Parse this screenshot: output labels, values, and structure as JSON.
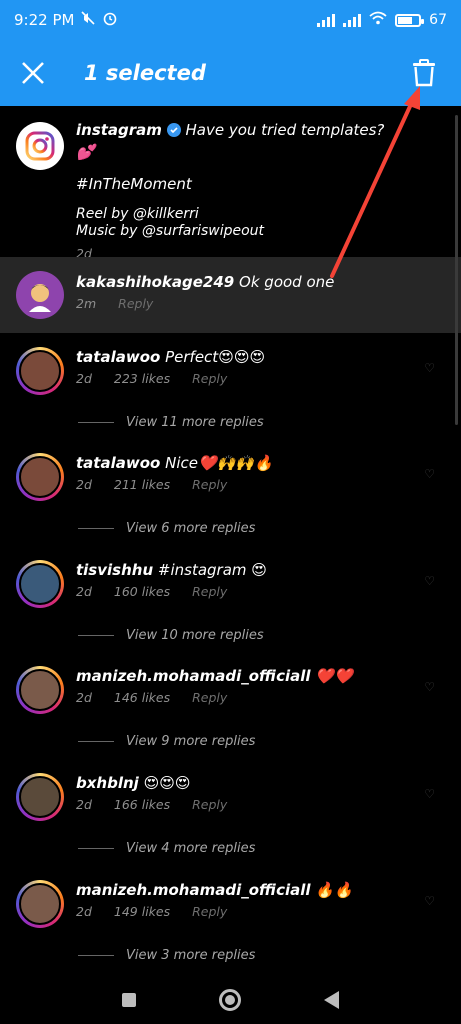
{
  "status_bar": {
    "time": "9:22 PM",
    "battery": "67",
    "battery_level": 0.67
  },
  "header": {
    "title": "1 selected",
    "close_icon": "close-icon",
    "delete_icon": "trash-icon"
  },
  "caption": {
    "username": "instagram",
    "verified": true,
    "text": "Have you tried templates? 💕",
    "hashtag": "#InTheMoment",
    "reel_line": "Reel by @killkerri",
    "music_line": "Music by @surfariswipeout",
    "time": "2d"
  },
  "selected_comment": {
    "username": "kakashihokage249",
    "text": "Ok good one",
    "time": "2m",
    "reply": "Reply"
  },
  "comments": [
    {
      "username": "tatalawoo",
      "text": "Perfect😍😍😍",
      "time": "2d",
      "likes": "223 likes",
      "reply": "Reply",
      "view_replies": "View 11 more replies"
    },
    {
      "username": "tatalawoo",
      "text": "Nice❤️🙌🙌🔥",
      "time": "2d",
      "likes": "211 likes",
      "reply": "Reply",
      "view_replies": "View 6 more replies"
    },
    {
      "username": "tisvishhu",
      "text": "#instagram 😍",
      "time": "2d",
      "likes": "160 likes",
      "reply": "Reply",
      "view_replies": "View 10 more replies"
    },
    {
      "username": "manizeh.mohamadi_officiall",
      "text": "❤️❤️",
      "time": "2d",
      "likes": "146 likes",
      "reply": "Reply",
      "view_replies": "View 9 more replies"
    },
    {
      "username": "bxhblnj",
      "text": "😍😍😍",
      "time": "2d",
      "likes": "166 likes",
      "reply": "Reply",
      "view_replies": "View 4 more replies"
    },
    {
      "username": "manizeh.mohamadi_officiall",
      "text": "🔥🔥",
      "time": "2d",
      "likes": "149 likes",
      "reply": "Reply",
      "view_replies": "View 3 more replies"
    }
  ],
  "colors": {
    "accent": "#2196f3",
    "selected_bg": "#262626",
    "annotation_arrow": "#f44336"
  }
}
